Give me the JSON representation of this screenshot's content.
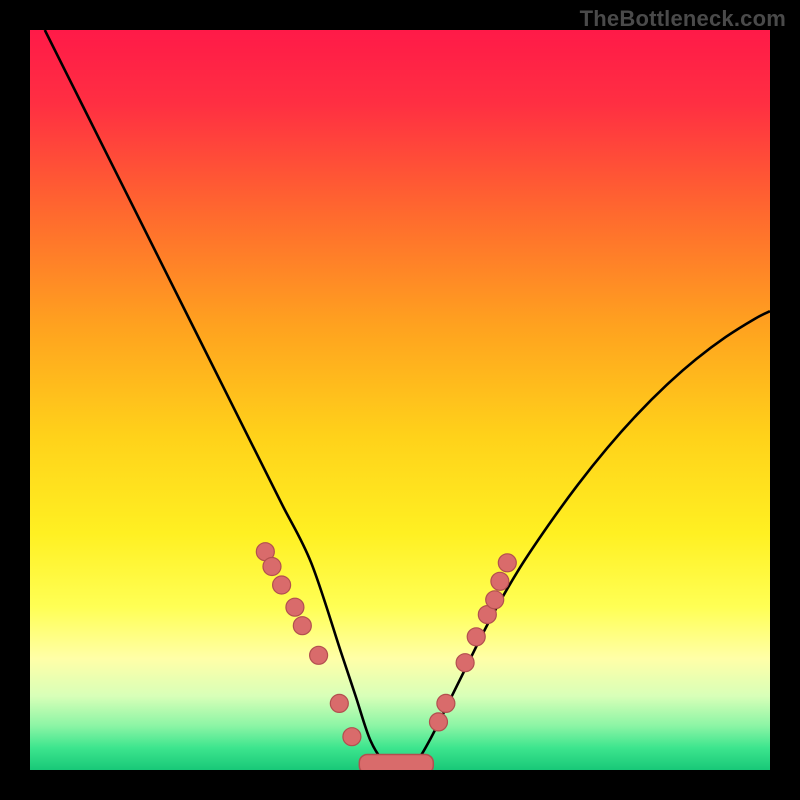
{
  "watermark": "TheBottleneck.com",
  "chart_data": {
    "type": "line",
    "title": "",
    "xlabel": "",
    "ylabel": "",
    "xlim": [
      0,
      100
    ],
    "ylim": [
      0,
      100
    ],
    "background_gradient_stops": [
      {
        "offset": 0.0,
        "color": "#ff1a48"
      },
      {
        "offset": 0.1,
        "color": "#ff2f42"
      },
      {
        "offset": 0.25,
        "color": "#ff6a2e"
      },
      {
        "offset": 0.4,
        "color": "#ffa21f"
      },
      {
        "offset": 0.55,
        "color": "#ffd21a"
      },
      {
        "offset": 0.68,
        "color": "#fff022"
      },
      {
        "offset": 0.78,
        "color": "#ffff55"
      },
      {
        "offset": 0.85,
        "color": "#ffffa8"
      },
      {
        "offset": 0.9,
        "color": "#d8ffb8"
      },
      {
        "offset": 0.94,
        "color": "#8cf5a5"
      },
      {
        "offset": 0.97,
        "color": "#3de58e"
      },
      {
        "offset": 1.0,
        "color": "#18c878"
      }
    ],
    "series": [
      {
        "name": "bottleneck_curve",
        "x": [
          2,
          6,
          10,
          14,
          18,
          22,
          26,
          30,
          34,
          38,
          42,
          44,
          46,
          48,
          50,
          52,
          54,
          58,
          62,
          66,
          70,
          74,
          78,
          82,
          86,
          90,
          94,
          98,
          100
        ],
        "y": [
          100,
          92,
          84,
          76,
          68,
          60,
          52,
          44,
          36,
          28,
          16,
          10,
          4,
          1,
          0.5,
          1,
          4,
          12,
          20,
          27,
          33,
          38.5,
          43.5,
          48,
          52,
          55.5,
          58.5,
          61,
          62
        ],
        "stroke": "#000000",
        "stroke_width": 2.6
      }
    ],
    "markers": {
      "name": "highlighted_points",
      "fill": "#d96b6b",
      "stroke": "#b24f4f",
      "radius": 9,
      "points": [
        {
          "x": 31.8,
          "y": 29.5
        },
        {
          "x": 32.7,
          "y": 27.5
        },
        {
          "x": 34.0,
          "y": 25.0
        },
        {
          "x": 35.8,
          "y": 22.0
        },
        {
          "x": 36.8,
          "y": 19.5
        },
        {
          "x": 39.0,
          "y": 15.5
        },
        {
          "x": 41.8,
          "y": 9.0
        },
        {
          "x": 43.5,
          "y": 4.5
        },
        {
          "x": 55.2,
          "y": 6.5
        },
        {
          "x": 56.2,
          "y": 9.0
        },
        {
          "x": 58.8,
          "y": 14.5
        },
        {
          "x": 60.3,
          "y": 18.0
        },
        {
          "x": 61.8,
          "y": 21.0
        },
        {
          "x": 62.8,
          "y": 23.0
        },
        {
          "x": 63.5,
          "y": 25.5
        },
        {
          "x": 64.5,
          "y": 28.0
        }
      ]
    },
    "floor_bar": {
      "name": "min_region",
      "fill": "#d96b6b",
      "stroke": "#b24f4f",
      "x0": 44.5,
      "x1": 54.5,
      "y": 0.8,
      "height": 2.6
    }
  }
}
